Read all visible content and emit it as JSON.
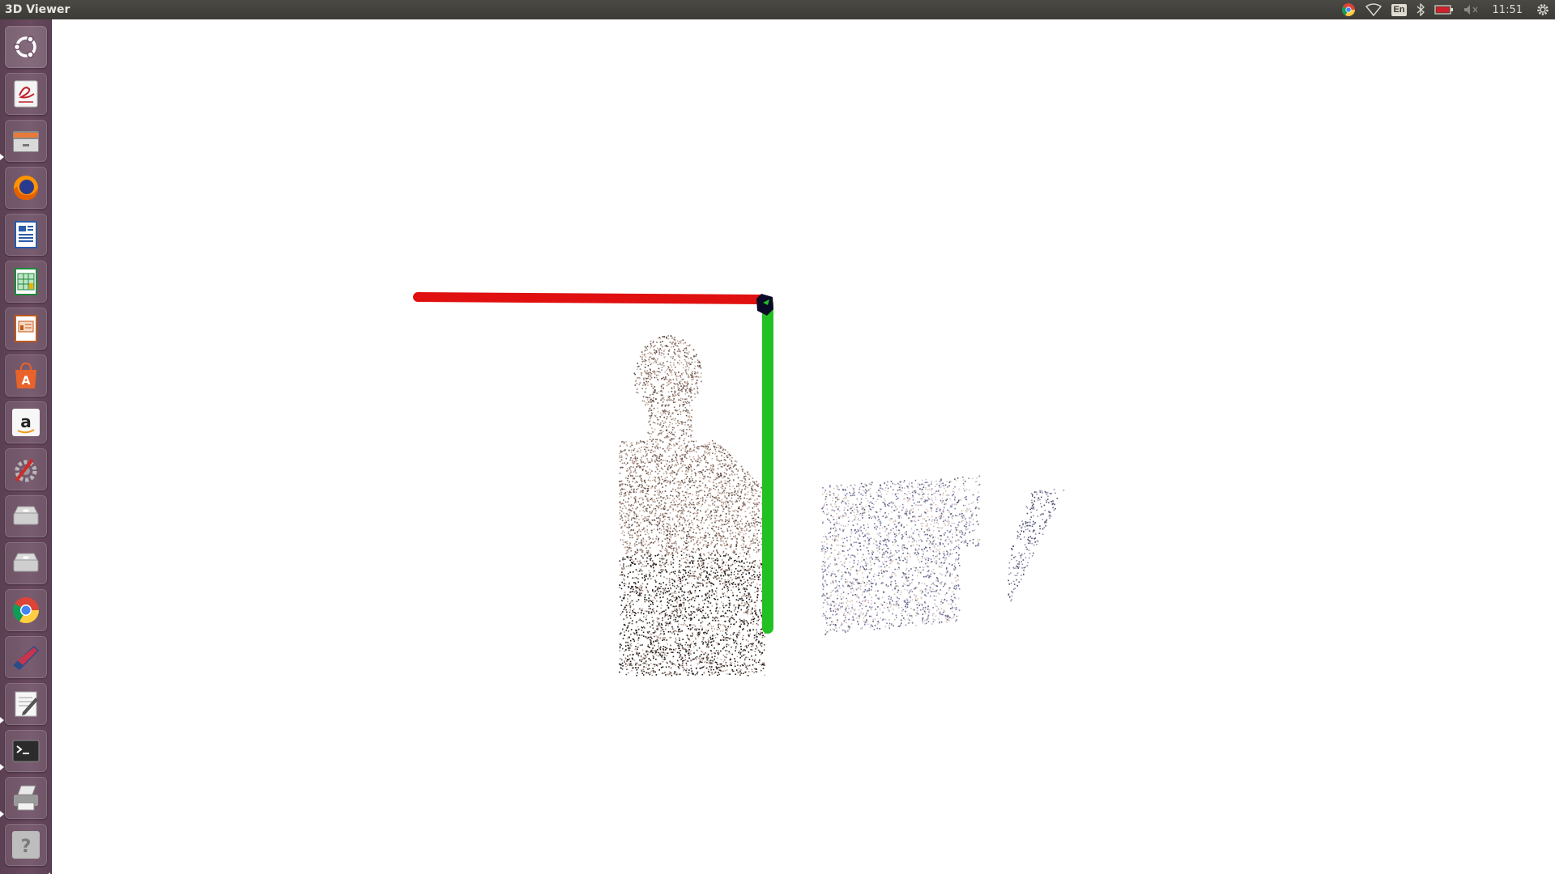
{
  "window": {
    "title": "3D Viewer"
  },
  "panel": {
    "clock": "11:51",
    "keyboard_layout": "En",
    "indicators": [
      "chrome-icon",
      "wifi-icon",
      "keyboard-icon",
      "bluetooth-icon",
      "battery-icon",
      "volume-muted-icon",
      "settings-gear-icon"
    ]
  },
  "launcher": {
    "items": [
      {
        "name": "dash-home",
        "icon": "ubuntu-logo-icon",
        "running": false
      },
      {
        "name": "evince",
        "icon": "document-viewer-icon",
        "running": false
      },
      {
        "name": "files",
        "icon": "file-manager-icon",
        "running": true
      },
      {
        "name": "firefox",
        "icon": "firefox-icon",
        "running": false
      },
      {
        "name": "writer",
        "icon": "libreoffice-writer-icon",
        "running": false
      },
      {
        "name": "calc",
        "icon": "libreoffice-calc-icon",
        "running": false
      },
      {
        "name": "impress",
        "icon": "libreoffice-impress-icon",
        "running": false
      },
      {
        "name": "software",
        "icon": "software-center-icon",
        "running": false
      },
      {
        "name": "amazon",
        "icon": "amazon-icon",
        "running": false
      },
      {
        "name": "system-settings",
        "icon": "system-settings-icon",
        "running": false
      },
      {
        "name": "drive-1",
        "icon": "drive-icon",
        "running": false
      },
      {
        "name": "drive-2",
        "icon": "drive-icon",
        "running": false
      },
      {
        "name": "chrome",
        "icon": "chrome-icon",
        "running": false
      },
      {
        "name": "pycharm",
        "icon": "ide-icon",
        "running": false
      },
      {
        "name": "text-editor",
        "icon": "text-editor-icon",
        "running": true
      },
      {
        "name": "terminal",
        "icon": "terminal-icon",
        "running": true
      },
      {
        "name": "printer",
        "icon": "printer-icon",
        "running": true
      },
      {
        "name": "help",
        "icon": "help-icon",
        "running": false
      }
    ]
  },
  "scene": {
    "axis_x_color": "#e01010",
    "axis_y_color": "#22c022",
    "origin_color": "#0a0a28"
  }
}
